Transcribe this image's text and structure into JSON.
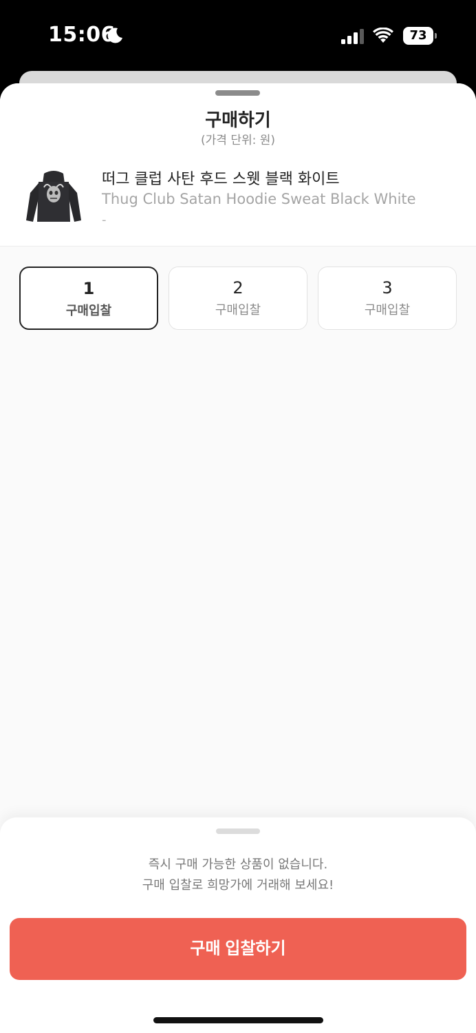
{
  "status_bar": {
    "time": "15:06",
    "battery": "73",
    "icons": [
      "moon-icon",
      "signal-icon",
      "wifi-icon",
      "battery-icon"
    ]
  },
  "sheet": {
    "title": "구매하기",
    "subtitle": "(가격 단위: 원)"
  },
  "product": {
    "image": "hoodie-product-image",
    "name_ko": "떠그 클럽 사탄 후드 스웻 블랙 화이트",
    "name_en": "Thug Club Satan Hoodie Sweat Black White",
    "option": "-"
  },
  "options": [
    {
      "size": "1",
      "label": "구매입찰",
      "selected": true
    },
    {
      "size": "2",
      "label": "구매입찰",
      "selected": false
    },
    {
      "size": "3",
      "label": "구매입찰",
      "selected": false
    }
  ],
  "bottom": {
    "notice_line1": "즉시 구매 가능한 상품이 없습니다.",
    "notice_line2": "구매 입찰로 희망가에 거래해 보세요!",
    "button_label": "구매 입찰하기"
  },
  "colors": {
    "accent": "#ef6153",
    "text": "#222222",
    "muted": "#8a8a8a"
  }
}
